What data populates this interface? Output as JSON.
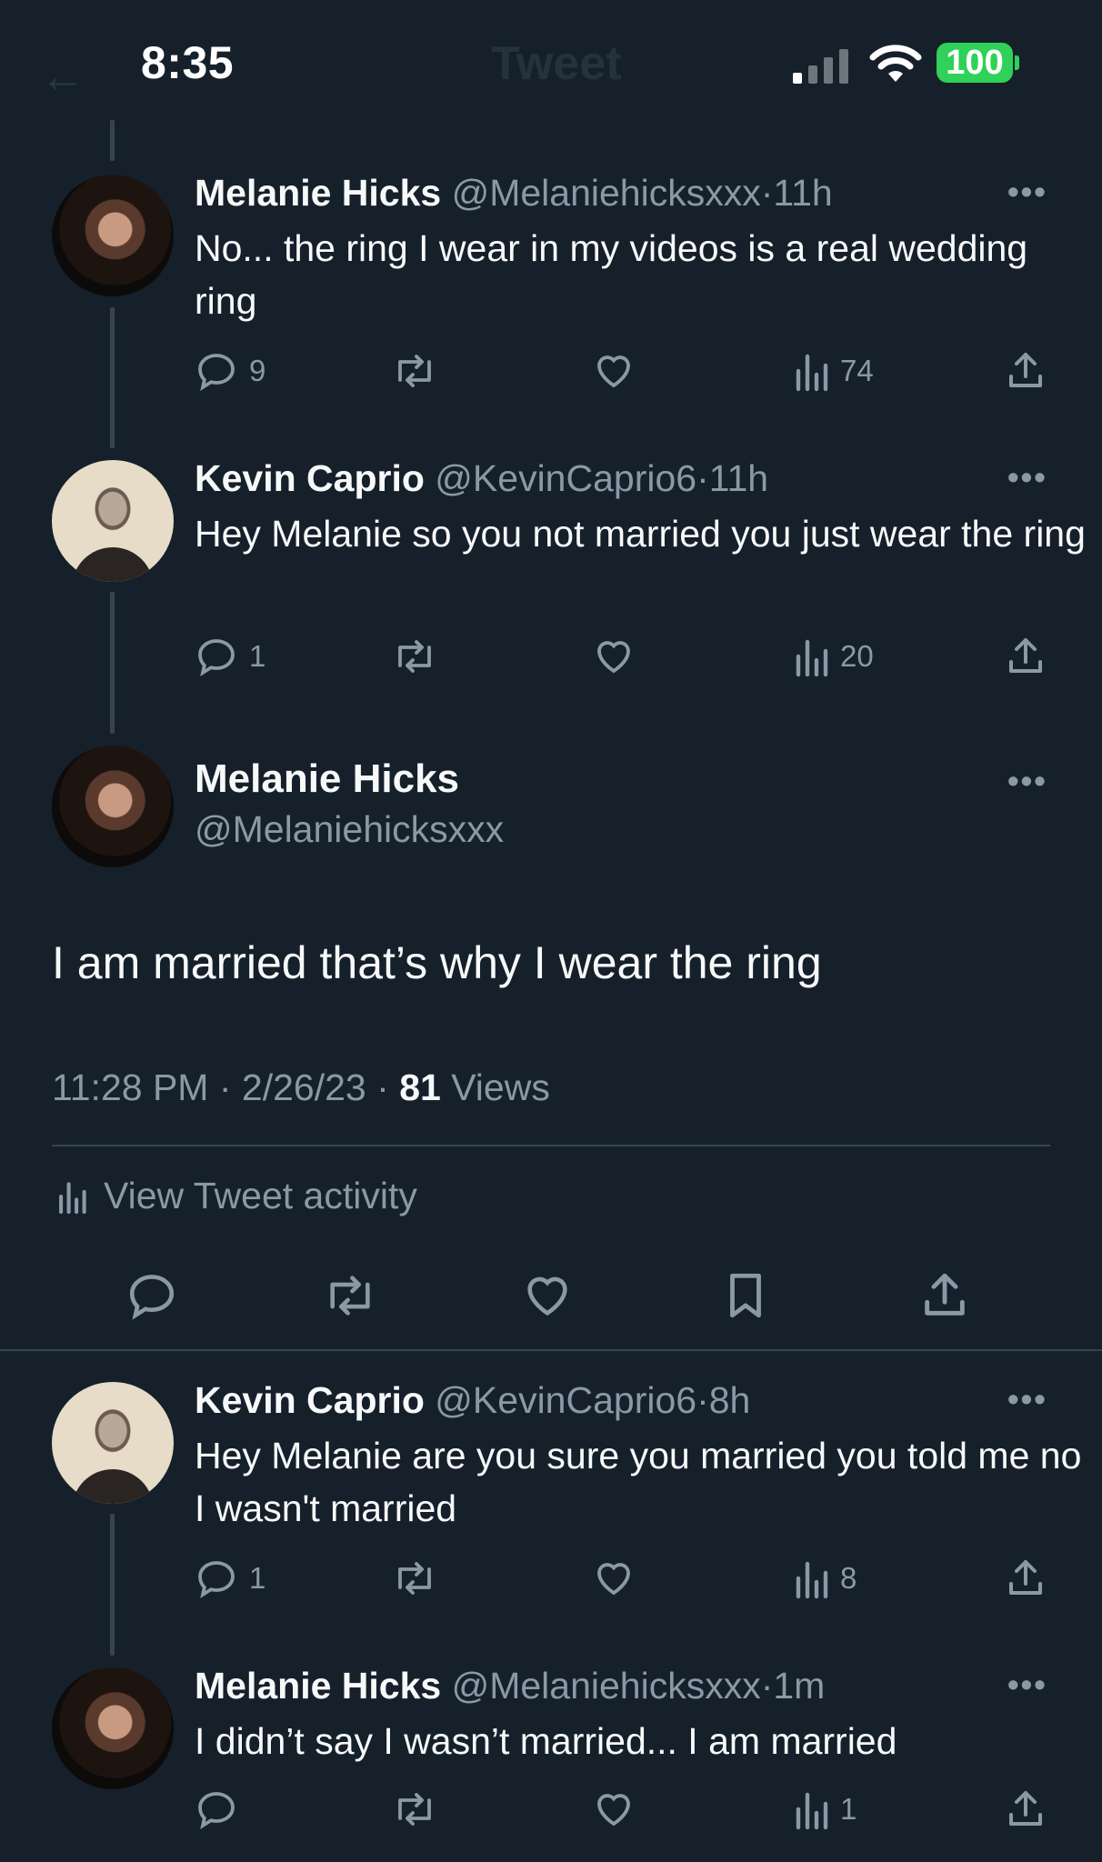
{
  "status_bar": {
    "time": "8:35",
    "battery": "100"
  },
  "ghost_header": {
    "back": "←",
    "title": "Tweet"
  },
  "tweets_above": [
    {
      "name": "Melanie Hicks",
      "handle": "@Melaniehicksxxx",
      "sep": "·",
      "time": "11h",
      "text": "No... the ring I wear in my videos is a real wedding ring",
      "replies": "9",
      "views": "74"
    },
    {
      "name": "Kevin Caprio",
      "handle": "@KevinCaprio6",
      "sep": "·",
      "time": "11h",
      "text": "Hey Melanie so you not married you just wear the ring",
      "replies": "1",
      "views": "20"
    }
  ],
  "focus_tweet": {
    "name": "Melanie Hicks",
    "handle": "@Melaniehicksxxx",
    "text": "I am married that’s why I wear the ring",
    "time": "11:28 PM",
    "date": "2/26/23",
    "views_count": "81",
    "views_label": "Views",
    "sep": "·",
    "activity_label": "View Tweet activity"
  },
  "tweets_below": [
    {
      "name": "Kevin Caprio",
      "handle": "@KevinCaprio6",
      "sep": "·",
      "time": "8h",
      "text": "Hey Melanie are you sure you married you told me no I wasn't married",
      "replies": "1",
      "views": "8"
    },
    {
      "name": "Melanie Hicks",
      "handle": "@Melaniehicksxxx",
      "sep": "·",
      "time": "1m",
      "text": "I didn’t say I wasn’t married... I am married",
      "replies": "",
      "views": "1"
    }
  ],
  "more_glyph": "•••",
  "colors": {
    "background": "#15202b",
    "text": "#f7f9f9",
    "secondary": "#8b98a5",
    "battery": "#30d158"
  }
}
